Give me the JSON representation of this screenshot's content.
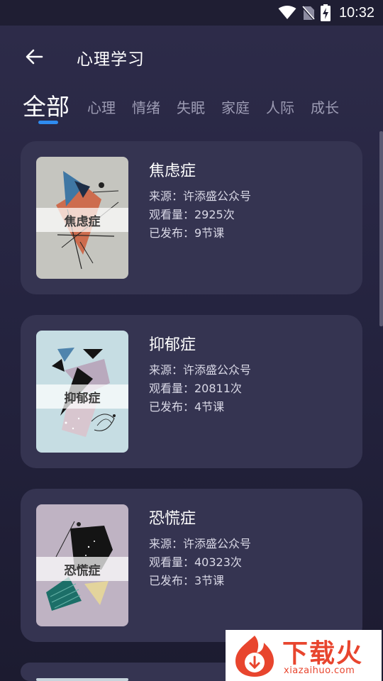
{
  "status_bar": {
    "time": "10:32",
    "icons": [
      "wifi-icon",
      "no-sim-icon",
      "battery-charging-icon"
    ]
  },
  "header": {
    "title": "心理学习",
    "back_icon": "arrow-left-icon"
  },
  "tabs": [
    {
      "label": "全部",
      "active": true
    },
    {
      "label": "心理",
      "active": false
    },
    {
      "label": "情绪",
      "active": false
    },
    {
      "label": "失眠",
      "active": false
    },
    {
      "label": "家庭",
      "active": false
    },
    {
      "label": "人际",
      "active": false
    },
    {
      "label": "成长",
      "active": false
    }
  ],
  "courses": [
    {
      "title": "焦虑症",
      "thumb_label": "焦虑症",
      "source": "来源：许添盛公众号",
      "views": "观看量：2925次",
      "published": "已发布：9节课"
    },
    {
      "title": "抑郁症",
      "thumb_label": "抑郁症",
      "source": "来源：许添盛公众号",
      "views": "观看量：20811次",
      "published": "已发布：4节课"
    },
    {
      "title": "恐慌症",
      "thumb_label": "恐慌症",
      "source": "来源：许添盛公众号",
      "views": "观看量：40323次",
      "published": "已发布：3节课"
    }
  ],
  "watermark": {
    "text": "下载火",
    "url": "xiazaihuo.com"
  },
  "colors": {
    "accent": "#2f8cf0",
    "card": "#353451",
    "background": "#252440",
    "watermark": "#e8452e"
  }
}
